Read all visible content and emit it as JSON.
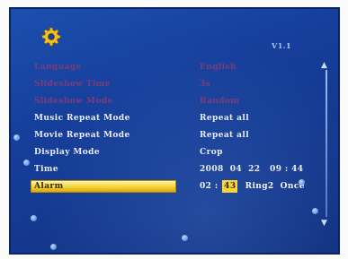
{
  "header": {
    "version": "V1.1"
  },
  "menu": {
    "items": [
      {
        "label": "Language",
        "value": "English",
        "style": "faint"
      },
      {
        "label": "Slideshow Time",
        "value": "3s",
        "style": "faint"
      },
      {
        "label": "Slideshow Mode",
        "value": "Random",
        "style": "faint"
      },
      {
        "label": "Music Repeat Mode",
        "value": "Repeat all",
        "style": "normal"
      },
      {
        "label": "Movie Repeat Mode",
        "value": "Repeat all",
        "style": "normal"
      },
      {
        "label": "Display Mode",
        "value": "Crop",
        "style": "normal"
      },
      {
        "label": "Time",
        "value": "2008  04  22   09 : 44",
        "style": "normal"
      },
      {
        "label": "Alarm",
        "style": "selected"
      }
    ],
    "alarm": {
      "hour": "02",
      "separator": ":",
      "minute": "43",
      "tone": "Ring2",
      "repeat": "Once"
    }
  },
  "colors": {
    "screen_bg": "#163f9b",
    "highlight": "#f4d33a",
    "faint_text": "#9c3a6b",
    "normal_text": "#e8ecf6"
  },
  "icons": [
    "gear-icon",
    "scroll-up-arrow-icon",
    "scroll-down-arrow-icon"
  ]
}
